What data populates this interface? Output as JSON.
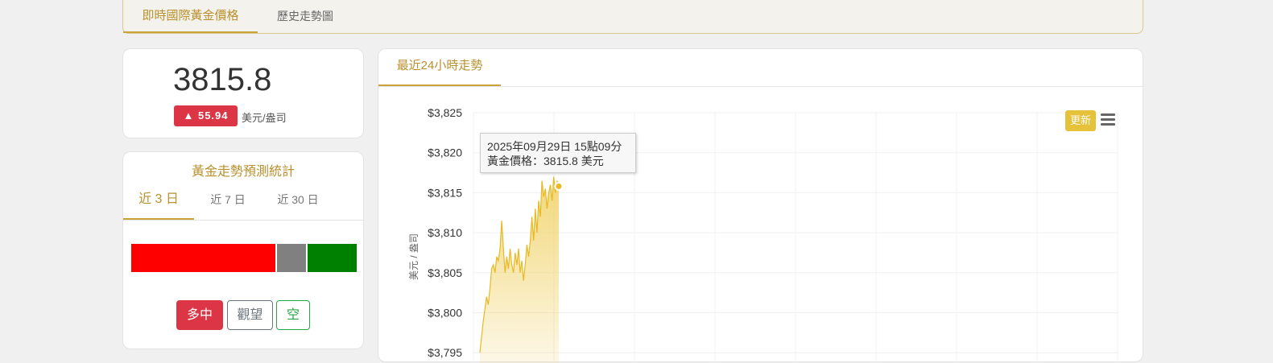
{
  "top_tabs": [
    {
      "label": "即時國際黃金價格",
      "active": true
    },
    {
      "label": "歷史走勢圖",
      "active": false
    }
  ],
  "price_card": {
    "price": "3815.8",
    "change": "▲ 55.94",
    "unit": "美元/盎司"
  },
  "forecast": {
    "title": "黃金走勢預測統計",
    "tabs": [
      {
        "label": "近 3 日",
        "active": true
      },
      {
        "label": "近 7 日",
        "active": false
      },
      {
        "label": "近 30 日",
        "active": false
      }
    ],
    "distribution": [
      {
        "name": "bull",
        "share": 0.65,
        "color": "#ff0000"
      },
      {
        "name": "neutral",
        "share": 0.13,
        "color": "#808080"
      },
      {
        "name": "bear",
        "share": 0.22,
        "color": "#008000"
      }
    ],
    "buttons": {
      "bull": "多中",
      "watch": "觀望",
      "bear": "空"
    }
  },
  "chart_panel": {
    "tab_label": "最近24小時走勢",
    "refresh_label": "更新",
    "tooltip": {
      "line1": "2025年09月29日 15點09分",
      "line2": "黃金價格：3815.8 美元"
    },
    "colors": {
      "accent": "#c9a23a",
      "line": "#e8b923",
      "fill": "#f0d060"
    }
  },
  "chart_data": {
    "type": "area",
    "title": "",
    "ylabel": "美元 / 盎司",
    "ytick_labels": [
      "$3,825",
      "$3,820",
      "$3,815",
      "$3,810",
      "$3,805",
      "$3,800",
      "$3,795"
    ],
    "yticks": [
      3825,
      3820,
      3815,
      3810,
      3805,
      3800,
      3795
    ],
    "ylim": [
      3795,
      3825
    ],
    "series": [
      {
        "values": [
          3795.0,
          3797.0,
          3799.0,
          3800.5,
          3802.0,
          3801.0,
          3803.0,
          3805.5,
          3806.0,
          3805.0,
          3807.0,
          3806.5,
          3808.0,
          3811.5,
          3808.0,
          3805.0,
          3807.0,
          3805.5,
          3808.0,
          3806.0,
          3805.0,
          3807.5,
          3806.0,
          3808.0,
          3805.0,
          3806.5,
          3804.0,
          3806.0,
          3808.5,
          3807.0,
          3809.0,
          3812.0,
          3809.0,
          3813.0,
          3810.0,
          3814.0,
          3812.0,
          3816.5,
          3814.5,
          3815.5,
          3813.0,
          3815.0,
          3816.0,
          3814.0,
          3817.0,
          3815.0,
          3816.5,
          3815.8
        ]
      }
    ]
  }
}
